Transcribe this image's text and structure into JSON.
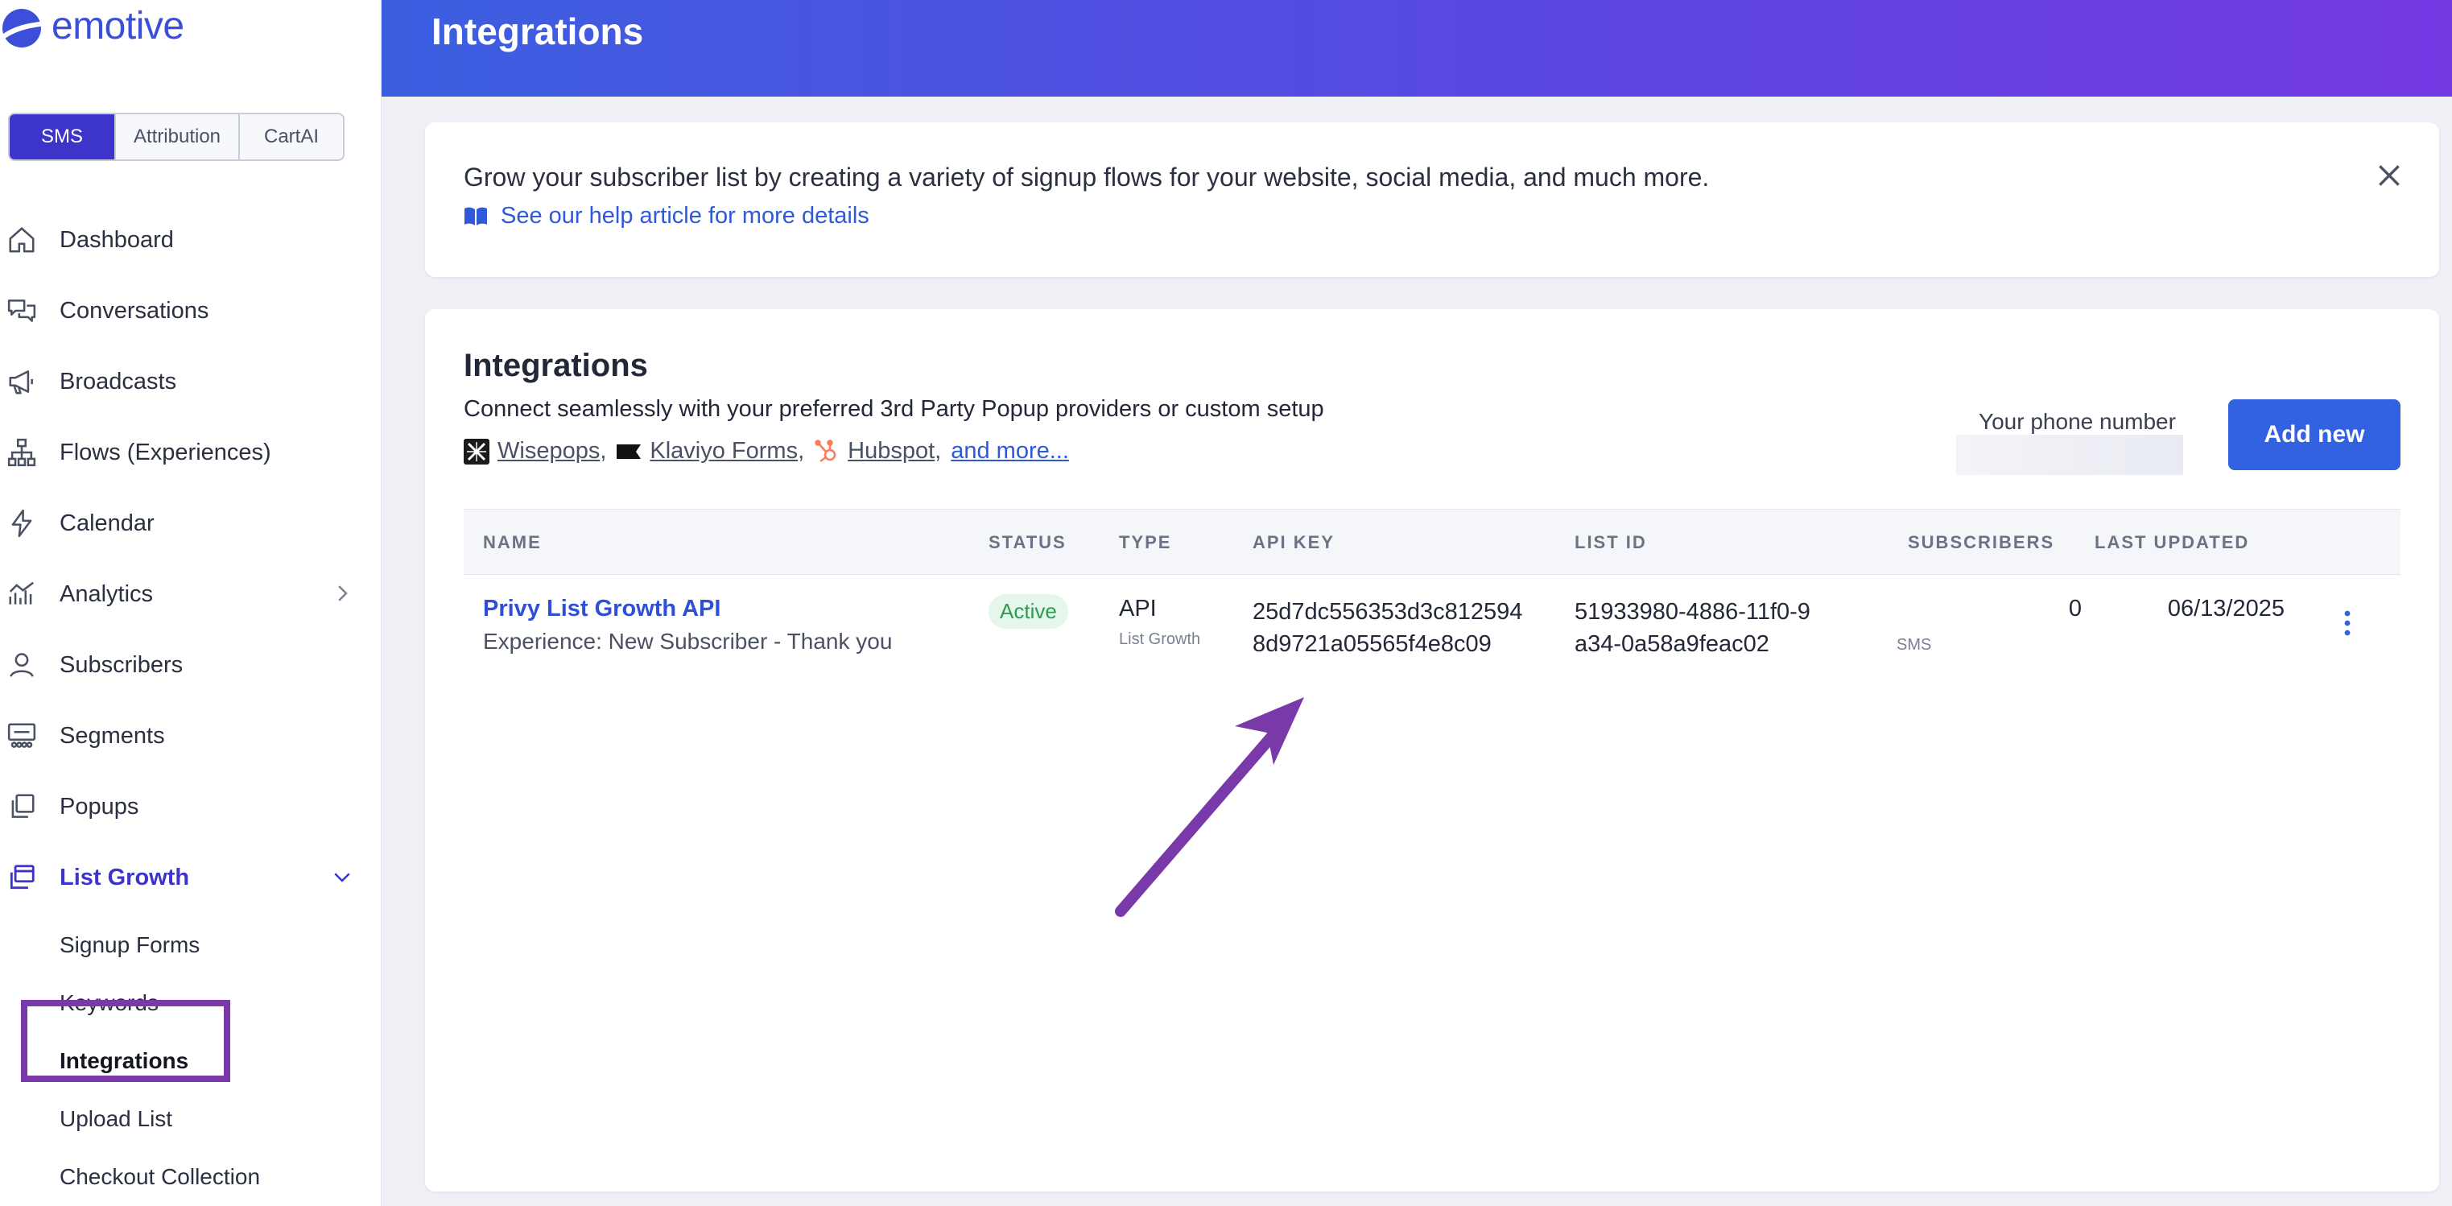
{
  "brand": {
    "name": "emotive",
    "color": "#3b4fd8"
  },
  "product_tabs": [
    {
      "label": "SMS",
      "active": true
    },
    {
      "label": "Attribution",
      "active": false
    },
    {
      "label": "CartAI",
      "active": false
    }
  ],
  "sidebar": {
    "items": [
      {
        "label": "Dashboard",
        "icon": "home-icon"
      },
      {
        "label": "Conversations",
        "icon": "chat-bubbles-icon"
      },
      {
        "label": "Broadcasts",
        "icon": "megaphone-icon"
      },
      {
        "label": "Flows (Experiences)",
        "icon": "flow-tree-icon"
      },
      {
        "label": "Calendar",
        "icon": "lightning-icon"
      },
      {
        "label": "Analytics",
        "icon": "chart-icon",
        "chevron": "chevron-right-icon"
      },
      {
        "label": "Subscribers",
        "icon": "user-icon"
      },
      {
        "label": "Segments",
        "icon": "segments-icon"
      },
      {
        "label": "Popups",
        "icon": "popups-icon"
      },
      {
        "label": "List Growth",
        "icon": "windows-icon",
        "chevron": "chevron-down-icon",
        "active": true
      }
    ],
    "list_growth_sub": [
      {
        "label": "Signup Forms"
      },
      {
        "label": "Keywords"
      },
      {
        "label": "Integrations",
        "current": true
      },
      {
        "label": "Upload List"
      },
      {
        "label": "Checkout Collection"
      }
    ]
  },
  "header": {
    "title": "Integrations"
  },
  "info_card": {
    "text": "Grow your subscriber list by creating a variety of signup flows for your website, social media, and much more.",
    "help_link": "See our help article for more details"
  },
  "integrations": {
    "title": "Integrations",
    "description": "Connect seamlessly with your preferred 3rd Party Popup providers or custom setup",
    "providers": [
      {
        "name": "Wisepops",
        "icon": "wisepops-icon"
      },
      {
        "name": "Klaviyo Forms",
        "icon": "klaviyo-flag-icon"
      },
      {
        "name": "Hubspot",
        "icon": "hubspot-icon"
      }
    ],
    "providers_sep": ",",
    "more_link": "and more...",
    "phone_label": "Your phone number",
    "phone_value": "",
    "add_button": "Add new",
    "columns": [
      "NAME",
      "STATUS",
      "TYPE",
      "API KEY",
      "LIST ID",
      "SUBSCRIBERS",
      "LAST UPDATED"
    ],
    "rows": [
      {
        "name": "Privy List Growth API",
        "experience": "Experience: New Subscriber - Thank you",
        "status": "Active",
        "type": "API",
        "type_sub": "List Growth",
        "api_key": "25d7dc556353d3c8125948d9721a05565f4e8c09",
        "list_id": "51933980-4886-11f0-9a34-0a58a9feac02",
        "subscribers": "0",
        "subscribers_channel": "SMS",
        "last_updated": "06/13/2025"
      }
    ]
  },
  "colors": {
    "accent": "#3d35c9",
    "link": "#2f59d6",
    "button": "#3262e0",
    "status_active_bg": "#e5f6ea",
    "status_active_text": "#2e9a52",
    "annotation": "#7a39a9"
  }
}
